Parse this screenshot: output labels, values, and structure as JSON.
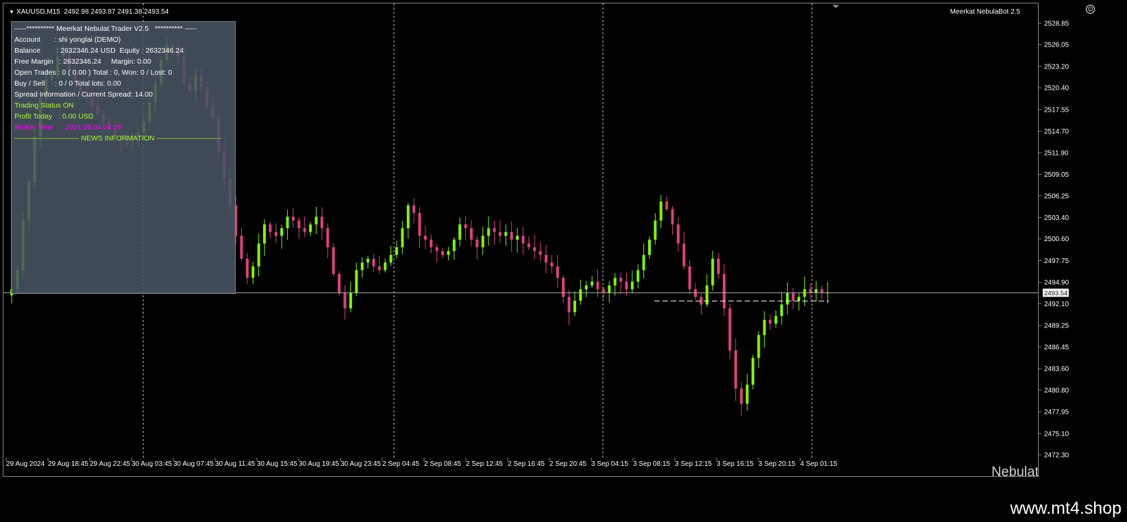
{
  "header": {
    "symbol": "XAUUSD,M15",
    "ohlc": "2492.98 2493.87 2491.38 2493.54"
  },
  "ea_label": "Meerkat NebulaBot 2.5",
  "smiley_icon": "smiley-face-icon",
  "info_panel": {
    "title": "-----********** Meerkat Nebulat Trader V2.5   ********** -----",
    "account": "Account       : shi yonglai (DEMO)",
    "balance": "Balance        : 2632346.24 USD  Equity : 2632346.24",
    "free_margin": "Free Margin   : 2632346.24     Margin: 0.00",
    "open_trades": "Open Trades : 0 ( 0.00 ) Total : 0, Won: 0 / Lost: 0",
    "buy_sell": "Buy / Sell     : 0 / 0 Total lots: 0.00",
    "spread": "Spread Information / Current Spread: 14.00",
    "trading_status": "Trading Status ON",
    "profit_today": "Profit Today   : 0.00 USD",
    "broker_time": "Broker Time    : 2024.09.04 04:29",
    "news": "--------------------------- NEWS INFORMATION ---------------------------",
    "colors": {
      "normal": "#ffffff",
      "status": "#adff2f",
      "broker": "#ff00ff",
      "news": "#adff2f"
    }
  },
  "watermark": "Nebulat",
  "footer_url": "www.mt4.shop",
  "colors": {
    "bull": "#7cfc00",
    "bear": "#e0407a",
    "grid": "#c8c8c8",
    "bid_line": "#b0b0b0"
  },
  "chart_data": {
    "type": "candlestick",
    "symbol": "XAUUSD",
    "timeframe": "M15",
    "y_ticks": [
      "2528.85",
      "2526.05",
      "2523.20",
      "2520.40",
      "2517.55",
      "2514.70",
      "2511.90",
      "2509.05",
      "2506.25",
      "2503.40",
      "2500.60",
      "2497.75",
      "2494.90",
      "2492.10",
      "2489.25",
      "2486.45",
      "2483.60",
      "2480.80",
      "2477.95",
      "2475.10",
      "2472.30"
    ],
    "ylim": [
      2472.3,
      2528.85
    ],
    "current_price": "2493.54",
    "x_ticks": [
      "29 Aug 2024",
      "29 Aug 18:45",
      "29 Aug 22:45",
      "30 Aug 03:45",
      "30 Aug 07:45",
      "30 Aug 11:45",
      "30 Aug 15:45",
      "30 Aug 19:45",
      "30 Aug 23:45",
      "2 Sep 04:45",
      "2 Sep 08:45",
      "2 Sep 12:45",
      "2 Sep 16:45",
      "2 Sep 20:45",
      "3 Sep 04:15",
      "3 Sep 08:15",
      "3 Sep 12:15",
      "3 Sep 16:15",
      "3 Sep 20:15",
      "4 Sep 01:15"
    ],
    "period_separators": [
      "29 Aug 22:45",
      "30 Aug 23:45",
      "2 Sep 20:45",
      "3 Sep 20:15"
    ],
    "close_path": [
      2494.0,
      2496.5,
      2503.0,
      2508.0,
      2514.0,
      2519.0,
      2521.5,
      2522.0,
      2524.5,
      2525.0,
      2522.5,
      2521.0,
      2520.0,
      2519.0,
      2518.0,
      2517.0,
      2516.0,
      2515.0,
      2514.0,
      2513.5,
      2513.8,
      2514.2,
      2514.5,
      2516.0,
      2518.5,
      2521.0,
      2524.0,
      2526.0,
      2525.5,
      2524.5,
      2521.0,
      2520.0,
      2522.0,
      2520.5,
      2518.0,
      2516.5,
      2512.0,
      2508.5,
      2505.0,
      2501.0,
      2498.0,
      2495.5,
      2497.0,
      2500.0,
      2502.5,
      2501.5,
      2501.0,
      2502.0,
      2503.5,
      2503.0,
      2502.0,
      2501.5,
      2502.5,
      2503.5,
      2502.0,
      2499.5,
      2496.0,
      2493.5,
      2491.5,
      2493.5,
      2496.5,
      2497.5,
      2498.0,
      2497.0,
      2496.5,
      2497.5,
      2498.5,
      2499.5,
      2502.0,
      2505.0,
      2504.0,
      2501.0,
      2500.5,
      2499.5,
      2499.0,
      2498.5,
      2499.0,
      2500.5,
      2502.5,
      2502.0,
      2500.5,
      2499.5,
      2501.0,
      2502.0,
      2501.5,
      2501.0,
      2501.5,
      2500.5,
      2501.0,
      2500.0,
      2499.5,
      2499.0,
      2498.5,
      2497.5,
      2497.0,
      2495.5,
      2493.0,
      2491.0,
      2492.5,
      2494.0,
      2494.5,
      2495.0,
      2494.0,
      2493.5,
      2494.5,
      2495.5,
      2495.0,
      2494.0,
      2495.0,
      2496.5,
      2498.5,
      2500.5,
      2503.0,
      2505.5,
      2504.5,
      2502.5,
      2500.0,
      2497.0,
      2494.0,
      2493.0,
      2492.0,
      2494.5,
      2498.0,
      2496.0,
      2491.5,
      2486.0,
      2481.0,
      2479.0,
      2481.5,
      2485.0,
      2488.0,
      2490.0,
      2489.5,
      2490.5,
      2492.0,
      2493.5,
      2492.5,
      2493.0,
      2494.0,
      2493.5,
      2494.0,
      2493.5,
      2493.54
    ]
  }
}
